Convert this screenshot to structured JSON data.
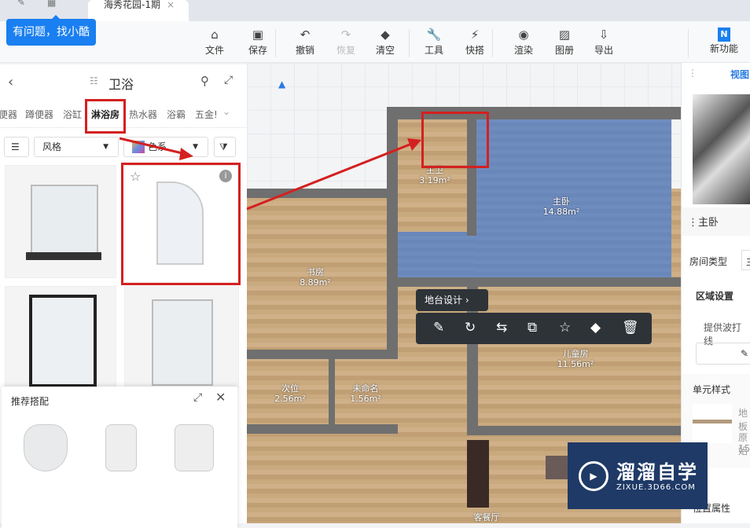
{
  "tabs": {
    "active_title": "海秀花园-1期",
    "close": "×"
  },
  "help": {
    "label": "有问题，找小酷"
  },
  "toolbar": [
    {
      "label": "文件",
      "icon": "file-icon",
      "glyph": "⌂"
    },
    {
      "label": "保存",
      "icon": "save-icon",
      "glyph": "▣"
    },
    {
      "label": "撤销",
      "icon": "undo-icon",
      "glyph": "↶"
    },
    {
      "label": "恢复",
      "icon": "redo-icon",
      "glyph": "↷",
      "disabled": true
    },
    {
      "label": "清空",
      "icon": "eraser-icon",
      "glyph": "◆"
    },
    {
      "label": "工具",
      "icon": "wrench-icon",
      "glyph": "🔧"
    },
    {
      "label": "快搭",
      "icon": "lightning-icon",
      "glyph": "⚡"
    },
    {
      "label": "渲染",
      "icon": "camera-icon",
      "glyph": "◉"
    },
    {
      "label": "图册",
      "icon": "image-icon",
      "glyph": "▨"
    },
    {
      "label": "导出",
      "icon": "export-icon",
      "glyph": "⇩"
    },
    {
      "label": "新功能",
      "icon": "new-icon",
      "glyph": "N"
    }
  ],
  "left_panel": {
    "title": "卫浴",
    "categories": [
      "便器",
      "蹲便器",
      "浴缸",
      "淋浴房",
      "热水器",
      "浴霸",
      "五金!"
    ],
    "active_category": "淋浴房",
    "style_select": "风格",
    "color_select": "色系",
    "recommend_title": "推荐搭配"
  },
  "floorplan": {
    "rooms": [
      {
        "name": "主卫",
        "area": "3.19m²"
      },
      {
        "name": "主卧",
        "area": "14.88m²"
      },
      {
        "name": "书房",
        "area": "8.89m²"
      },
      {
        "name": "儿童房",
        "area": "11.56m²"
      },
      {
        "name": "次位",
        "area": "2.56m²"
      },
      {
        "name": "未命名",
        "area": "1.56m²"
      },
      {
        "name": "客餐厅",
        "area": ""
      }
    ],
    "context_label": "地台设计",
    "context_tools": [
      "edit-icon",
      "rotate-icon",
      "flip-icon",
      "copy-icon",
      "favorite-icon",
      "eraser-icon",
      "delete-icon"
    ]
  },
  "right_panel": {
    "view_tab": "视图",
    "room_title": "主卧",
    "room_type_label": "房间类型",
    "room_type_value": "主",
    "area_settings": "区域设置",
    "hint": "提供波打线",
    "unit_style": "单元样式",
    "floor_label": "地板",
    "orig_label": "原始",
    "orig_value": "15",
    "prop_label": "位置属性"
  },
  "watermark": {
    "brand": "溜溜自学",
    "url": "ZIXUE.3D66.COM"
  }
}
